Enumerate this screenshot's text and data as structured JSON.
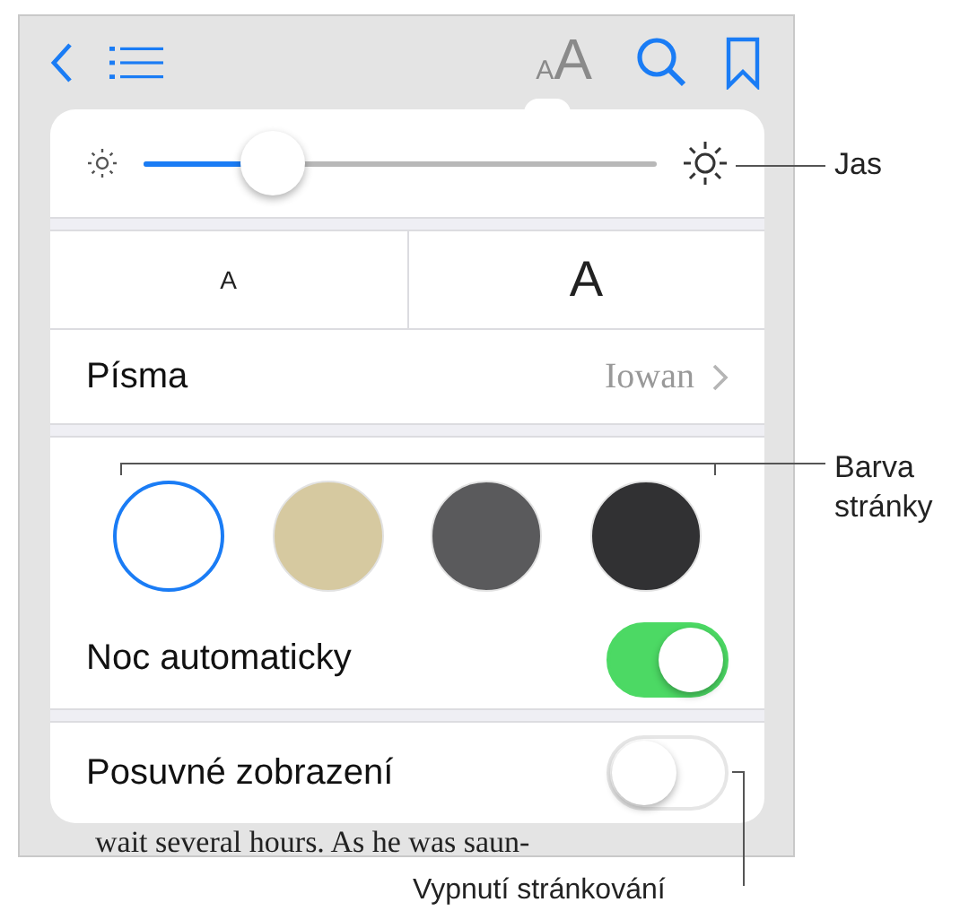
{
  "toolbar": {
    "font_button": {
      "small": "A",
      "large": "A"
    }
  },
  "brightness": {
    "level": 0.25
  },
  "font_size": {
    "smaller": "A",
    "larger": "A"
  },
  "fonts": {
    "label": "Písma",
    "value": "Iowan"
  },
  "page_colors": [
    {
      "color": "#ffffff",
      "selected": true
    },
    {
      "color": "#d6c9a0",
      "selected": false
    },
    {
      "color": "#5a5a5c",
      "selected": false
    },
    {
      "color": "#313133",
      "selected": false
    }
  ],
  "toggles": [
    {
      "label": "Noc automaticky",
      "on": true
    },
    {
      "label": "Posuvné zobrazení",
      "on": false
    }
  ],
  "book_text": "wait several hours. As he was saun-",
  "callouts": {
    "brightness": "Jas",
    "page_color": [
      "Barva",
      "stránky"
    ],
    "scroll": "Vypnutí stránkování"
  }
}
